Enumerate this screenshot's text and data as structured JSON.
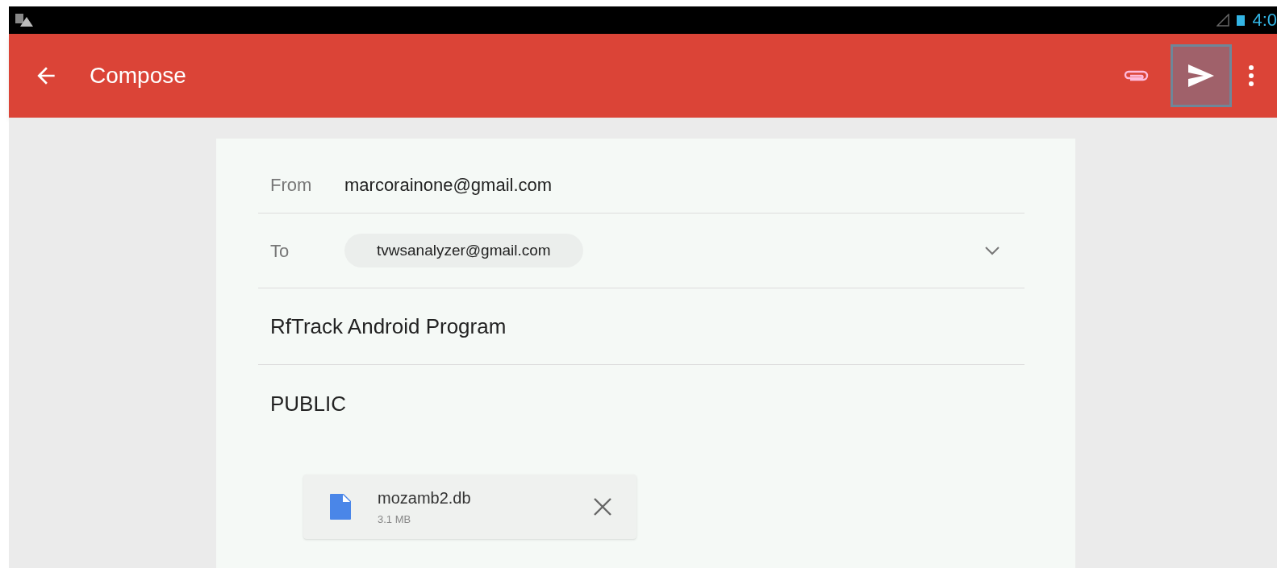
{
  "status_bar": {
    "time": "4:0"
  },
  "toolbar": {
    "title": "Compose",
    "send_highlighted": true
  },
  "from": {
    "label": "From",
    "value": "marcorainone@gmail.com"
  },
  "to": {
    "label": "To",
    "recipients": [
      "tvwsanalyzer@gmail.com"
    ]
  },
  "subject": "RfTrack Android Program",
  "body": "PUBLIC",
  "attachments": [
    {
      "name": "mozamb2.db",
      "size": "3.1 MB"
    }
  ]
}
